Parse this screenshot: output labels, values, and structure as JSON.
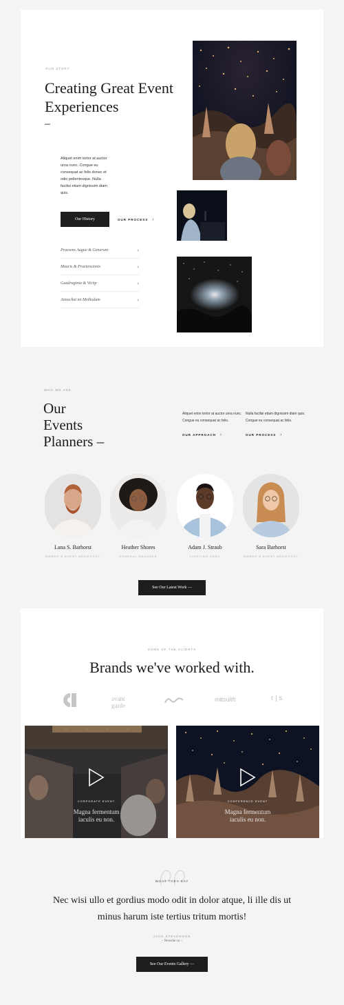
{
  "story": {
    "eyebrow": "OUR STORY",
    "title": "Creating Great Event Experiences",
    "dash": "–",
    "paragraph": "Aliquet enim tortor at auctor urna nunc. Congue eu consequat ac felis donec et odio pellentesque. Nulla facilisi etiam dignissim diam quis.",
    "primary_button": "Our History",
    "secondary_link": "OUR PROCESS",
    "list_items": [
      "Praesens Augue & Genarum",
      "Mauris & Praetensionis",
      "Guadraginta & Vicitp",
      "Annuchat mi Methodum"
    ]
  },
  "planners": {
    "eyebrow": "WHO WE ARE",
    "title_line1": "Our",
    "title_line2": "Events",
    "title_line3": "Planners –",
    "col1_text": "Aliquet enim tortor at auctor urna nunc. Congue eu consequat ac felis.",
    "col1_link": "OUR APPROACH",
    "col2_text": "Nulla facilisi etiam dignissim diam quis. Congue eu consequat ac felis.",
    "col2_link": "OUR PROCESS",
    "people": [
      {
        "name": "Lana S. Barhorst",
        "role": "OWNER & EVENT ARCHITECT"
      },
      {
        "name": "Heather Shores",
        "role": "GENERAL MANAGER"
      },
      {
        "name": "Adam J. Straub",
        "role": "LIGHTING HAND"
      },
      {
        "name": "Sara Barhorst",
        "role": "OWNER & EVENT ARCHITECT"
      }
    ],
    "cta": "See Our Latest Work —"
  },
  "brands": {
    "eyebrow": "SOME OF THE CLIENTS",
    "title": "Brands we've worked with.",
    "logos": [
      "c",
      "avant garde",
      "wave",
      "mitsulift",
      "r s"
    ],
    "logo_texts": {
      "avant": "avant garde",
      "mitsu": "mitsulift",
      "rs": "r | s"
    }
  },
  "videos": [
    {
      "label": "CORPORATE EVENT",
      "caption_line1": "Magna fermentum",
      "caption_line2": "iaculis eu non."
    },
    {
      "label": "CONFERENCE EVENT",
      "caption_line1": "Magna fermentum",
      "caption_line2": "iaculis eu non."
    }
  ],
  "testimonial": {
    "eyebrow": "WHAT THEY SAY",
    "quote_line1": "Nec wisi ullo et gordius modo odit in dolor atque, li ille dis ut",
    "quote_line2": "minus harum iste tertius tritum mortis!",
    "author": "JACK STEVENSON",
    "company": "– Newelle co –",
    "cta": "See Our Events Gallery —"
  },
  "colors": {
    "background": "#f4f4f4",
    "card": "#ffffff",
    "dark_button": "#1e1e1e",
    "text": "#1b1b1b"
  }
}
